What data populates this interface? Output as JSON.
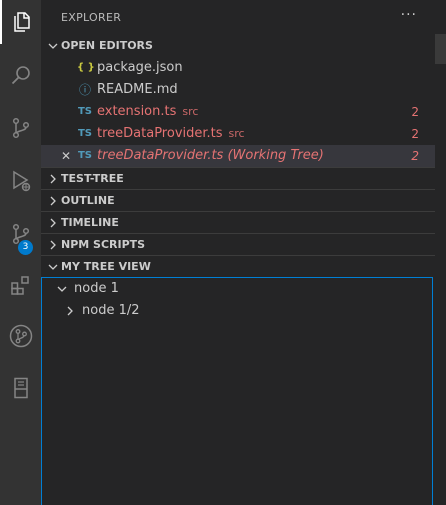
{
  "activity_bar": {
    "items": [
      {
        "name": "explorer",
        "icon": "files-icon",
        "active": true
      },
      {
        "name": "search",
        "icon": "search-icon"
      },
      {
        "name": "source-control",
        "icon": "source-control-icon"
      },
      {
        "name": "run-debug",
        "icon": "run-debug-icon"
      },
      {
        "name": "scm-extension",
        "icon": "git-branch-icon",
        "badge": "3"
      },
      {
        "name": "extensions",
        "icon": "extensions-icon"
      },
      {
        "name": "git-graph",
        "icon": "git-graph-icon"
      },
      {
        "name": "remote",
        "icon": "remote-explorer-icon"
      }
    ]
  },
  "explorer": {
    "title": "EXPLORER",
    "more_actions": "···"
  },
  "open_editors": {
    "label": "OPEN EDITORS",
    "items": [
      {
        "icon_glyph": "{ }",
        "icon_name": "json-icon",
        "icon_color": "#cbcb41",
        "name": "package.json",
        "description": "",
        "count": "",
        "name_color": "#cccccc"
      },
      {
        "icon_glyph": "ⓘ",
        "icon_name": "info-icon",
        "icon_color": "#519aba",
        "name": "README.md",
        "description": "",
        "count": "",
        "name_color": "#cccccc"
      },
      {
        "icon_glyph": "TS",
        "icon_name": "typescript-icon",
        "icon_color": "#519aba",
        "name": "extension.ts",
        "description": "src",
        "count": "2",
        "name_color": "#e57373"
      },
      {
        "icon_glyph": "TS",
        "icon_name": "typescript-icon",
        "icon_color": "#519aba",
        "name": "treeDataProvider.ts",
        "description": "src",
        "count": "2",
        "name_color": "#e57373"
      },
      {
        "icon_glyph": "TS",
        "icon_name": "typescript-icon",
        "icon_color": "#519aba",
        "name": "treeDataProvider.ts (Working Tree)",
        "description": "",
        "count": "2",
        "name_color": "#e57373",
        "italic": true,
        "selected": true,
        "close": "✕"
      }
    ]
  },
  "sections": [
    {
      "label": "TEST-TREE",
      "expanded": false
    },
    {
      "label": "OUTLINE",
      "expanded": false
    },
    {
      "label": "TIMELINE",
      "expanded": false
    },
    {
      "label": "NPM SCRIPTS",
      "expanded": false
    }
  ],
  "my_tree_view": {
    "label": "MY TREE VIEW",
    "nodes": [
      {
        "label": "node 1",
        "expanded": true,
        "depth": 0
      },
      {
        "label": "node 1/2",
        "expanded": false,
        "depth": 1
      }
    ]
  },
  "colors": {
    "activity_bar": "#333333",
    "sidebar": "#252526",
    "focus_border": "#007fd4",
    "badge": "#007acc",
    "error_text": "#e57373",
    "selection": "#37373d"
  }
}
